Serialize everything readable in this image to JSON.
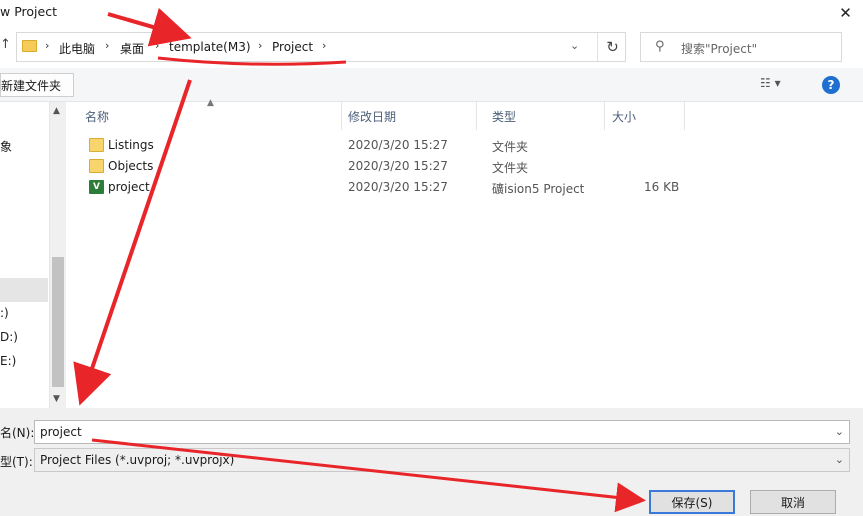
{
  "window": {
    "title": "w Project"
  },
  "address": {
    "crumbs": [
      "此电脑",
      "桌面",
      "template(M3)",
      "Project"
    ],
    "search_placeholder": "搜索\"Project\""
  },
  "toolbar": {
    "new_folder_label": "新建文件夹"
  },
  "nav": {
    "items": [
      "象",
      ":)",
      "D:)",
      "E:)"
    ]
  },
  "columns": {
    "name": "名称",
    "date": "修改日期",
    "type": "类型",
    "size": "大小"
  },
  "files": [
    {
      "name": "Listings",
      "date": "2020/3/20 15:27",
      "type": "文件夹",
      "size": "",
      "icon": "folder-icon"
    },
    {
      "name": "Objects",
      "date": "2020/3/20 15:27",
      "type": "文件夹",
      "size": "",
      "icon": "folder-icon"
    },
    {
      "name": "project",
      "date": "2020/3/20 15:27",
      "type": "礦ision5 Project",
      "size": "16 KB",
      "icon": "uvision-project-icon"
    }
  ],
  "save": {
    "filename_label": "名(N):",
    "filename_value": "project",
    "filetype_label": "型(T):",
    "filetype_value": "Project Files (*.uvproj; *.uvprojx)",
    "save_button": "保存(S)",
    "cancel_button": "取消"
  },
  "colors": {
    "annotation_arrow": "#e8262a",
    "accent": "#1f6fd0"
  }
}
